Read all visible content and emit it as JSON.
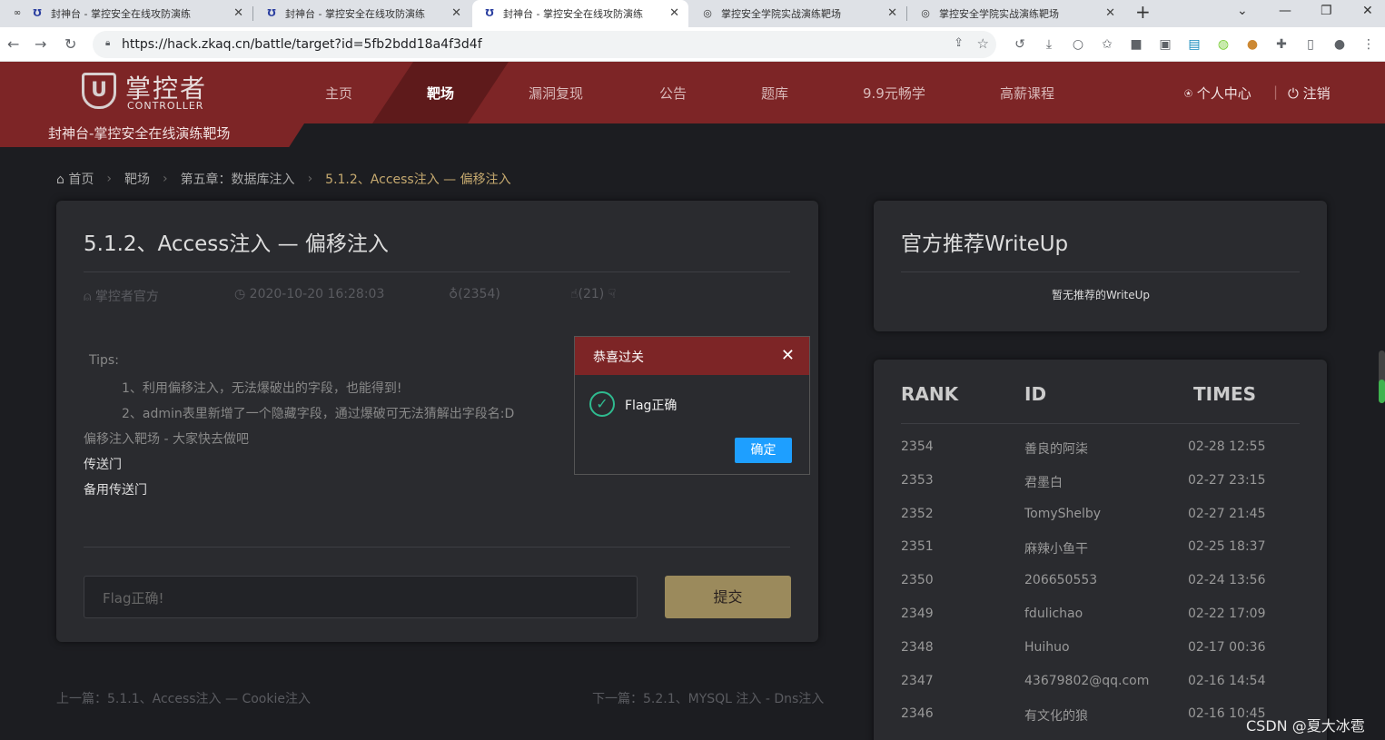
{
  "browser": {
    "tabs": [
      {
        "title": "封神台 - 掌控安全在线攻防演练"
      },
      {
        "title": "封神台 - 掌控安全在线攻防演练"
      },
      {
        "title": "封神台 - 掌控安全在线攻防演练"
      },
      {
        "title": "掌控安全学院实战演练靶场"
      },
      {
        "title": "掌控安全学院实战演练靶场"
      }
    ],
    "new_tab": "+",
    "url": "https://hack.zkaq.cn/battle/target?id=5fb2bdd18a4f3d4f"
  },
  "header": {
    "logo_name": "掌控者",
    "logo_sub": "CONTROLLER",
    "nav": [
      "主页",
      "靶场",
      "漏洞复现",
      "公告",
      "题库",
      "9.9元畅学",
      "高薪课程"
    ],
    "user_center": "个人中心",
    "logout": "注销",
    "subtitle": "封神台-掌控安全在线演练靶场"
  },
  "breadcrumb": {
    "home": "首页",
    "items": [
      "靶场",
      "第五章：数据库注入",
      "5.1.2、Access注入 — 偏移注入"
    ]
  },
  "challenge": {
    "title": "5.1.2、Access注入 — 偏移注入",
    "author": "掌控者官方",
    "date": "2020-10-20 16:28:03",
    "views": "(2354)",
    "likes": "(21)",
    "tips_label": "Tips:",
    "tip1": "1、利用偏移注入，无法爆破出的字段，也能得到!",
    "tip2": "2、admin表里新增了一个隐藏字段，通过爆破可无法猜解出字段名:D",
    "line3": "偏移注入靶场 - 大家快去做吧",
    "portal": "传送门",
    "backup_portal": "备用传送门",
    "flag_placeholder": "Flag正确!",
    "submit": "提交"
  },
  "writeup": {
    "title": "官方推荐WriteUp",
    "empty": "暂无推荐的WriteUp"
  },
  "rank": {
    "headers": [
      "RANK",
      "ID",
      "TIMES"
    ],
    "rows": [
      {
        "rank": "2354",
        "id": "善良的阿柒",
        "time": "02-28 12:55"
      },
      {
        "rank": "2353",
        "id": "君墨白",
        "time": "02-27 23:15"
      },
      {
        "rank": "2352",
        "id": "TomyShelby",
        "time": "02-27 21:45"
      },
      {
        "rank": "2351",
        "id": "麻辣小鱼干",
        "time": "02-25 18:37"
      },
      {
        "rank": "2350",
        "id": "206650553",
        "time": "02-24 13:56"
      },
      {
        "rank": "2349",
        "id": "fdulichao",
        "time": "02-22 17:09"
      },
      {
        "rank": "2348",
        "id": "Huihuo",
        "time": "02-17 00:36"
      },
      {
        "rank": "2347",
        "id": "43679802@qq.com",
        "time": "02-16 14:54"
      },
      {
        "rank": "2346",
        "id": "有文化的狼",
        "time": "02-16 10:45"
      }
    ]
  },
  "pager": {
    "prev": "上一篇：5.1.1、Access注入 — Cookie注入",
    "next": "下一篇：5.2.1、MYSQL 注入 - Dns注入"
  },
  "modal": {
    "title": "恭喜过关",
    "message": "Flag正确",
    "ok": "确定"
  },
  "watermark": "CSDN @夏大冰雹",
  "colors": {
    "brand": "#7d2526",
    "accent": "#c5a96f",
    "button": "#9b8a5c",
    "ok": "#1e9fff"
  }
}
